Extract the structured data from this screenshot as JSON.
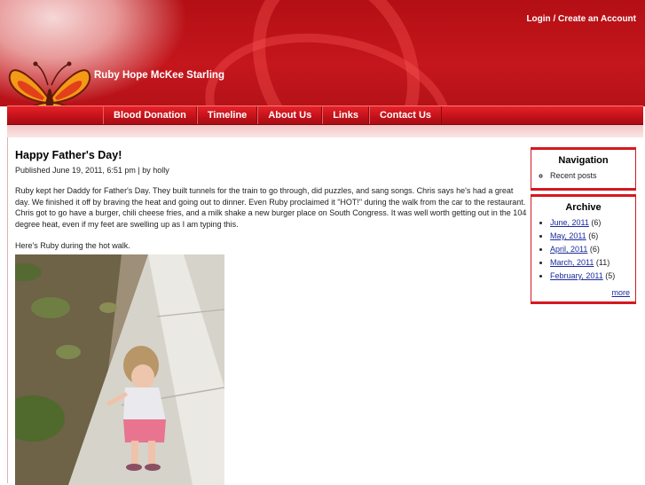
{
  "header": {
    "site_name": "Ruby Hope McKee Starling",
    "login_label": "Login",
    "login_separator": " / ",
    "create_account_label": "Create an Account"
  },
  "nav": {
    "items": [
      {
        "label": "Blood Donation"
      },
      {
        "label": "Timeline"
      },
      {
        "label": "About Us"
      },
      {
        "label": "Links"
      },
      {
        "label": "Contact Us"
      }
    ]
  },
  "post": {
    "title": "Happy Father's Day!",
    "meta": "Published June 19, 2011, 6:51 pm | by holly",
    "para1": "Ruby kept her Daddy for Father's Day.  They built tunnels for the train to go through, did puzzles, and sang songs.  Chris says he's had a great day.  We finished it off by braving the heat and going out to dinner.  Even Ruby proclaimed it \"HOT!\" during the walk from the car to the restaurant.  Chris got to go have a burger, chili cheese fries, and a milk shake a new burger place on South Congress.  It was well worth getting out in the 104 degree heat, even if my feet are swelling up as I am typing this.",
    "para2": "Here's Ruby during the hot walk."
  },
  "sidebar": {
    "navigation": {
      "title": "Navigation",
      "items": [
        {
          "label": "Recent posts"
        }
      ]
    },
    "archive": {
      "title": "Archive",
      "items": [
        {
          "label": "June, 2011",
          "count": "(6)"
        },
        {
          "label": "May, 2011",
          "count": "(6)"
        },
        {
          "label": "April, 2011",
          "count": "(6)"
        },
        {
          "label": "March, 2011",
          "count": "(11)"
        },
        {
          "label": "February, 2011",
          "count": "(5)"
        }
      ],
      "more_label": "more"
    }
  },
  "colors": {
    "header_red": "#c4161c",
    "link_blue": "#1b2a9e"
  },
  "icons": {
    "logo": "butterfly-icon"
  }
}
